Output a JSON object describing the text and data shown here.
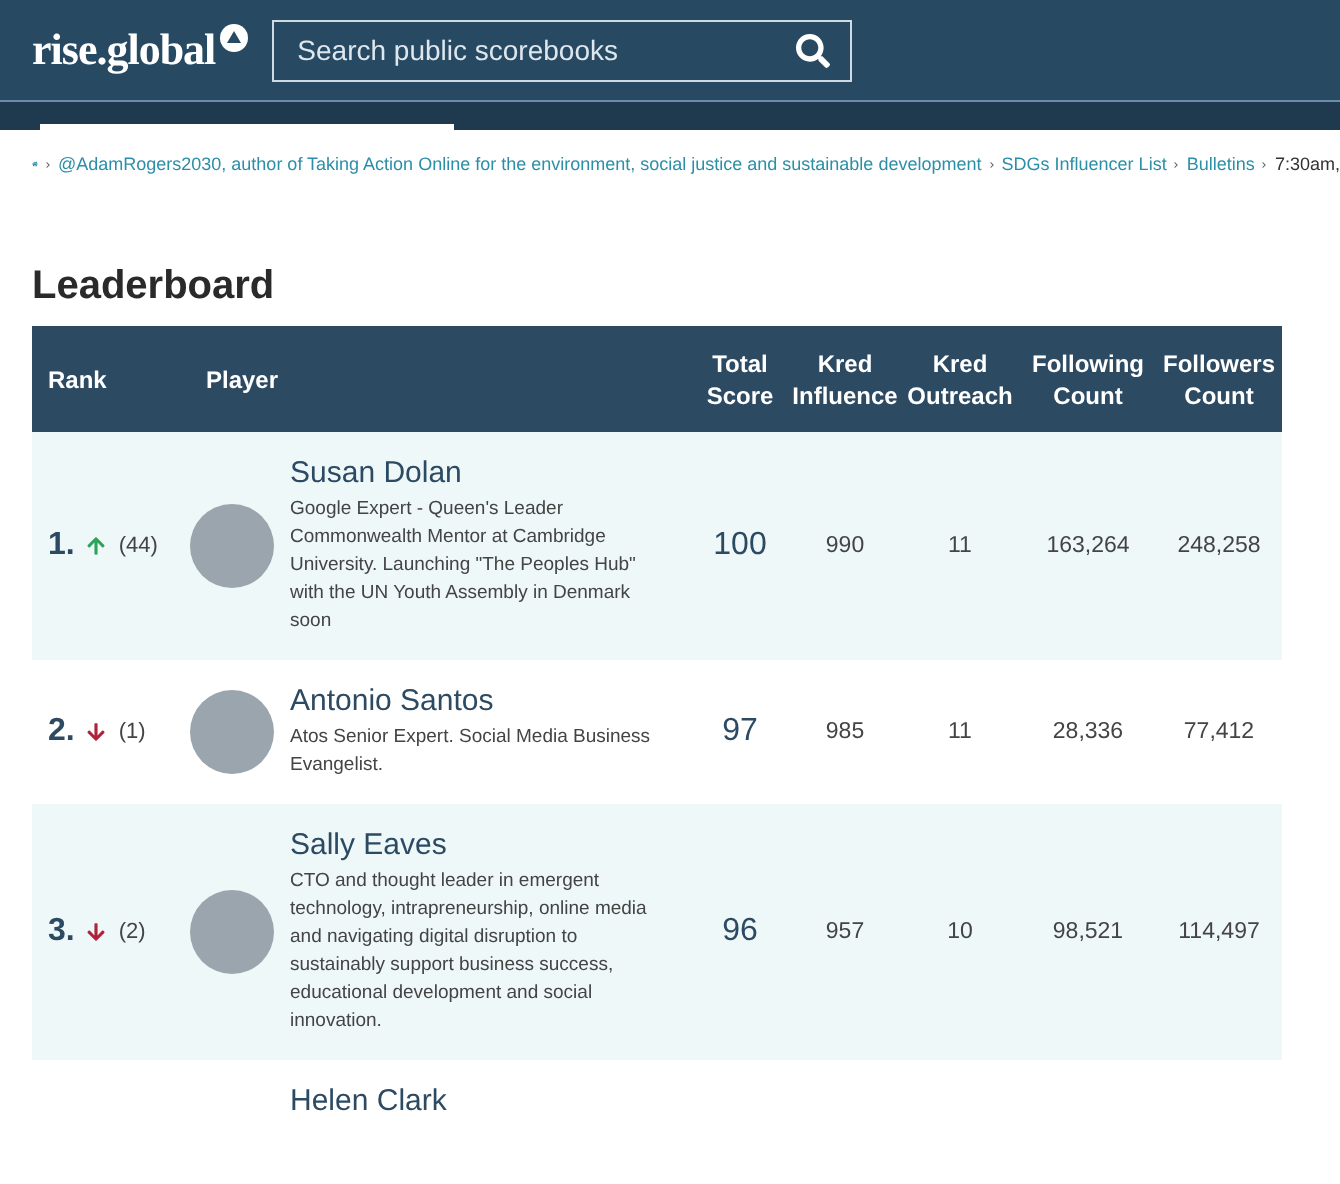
{
  "header": {
    "logo": "rise.global",
    "search": {
      "placeholder": "Search public scorebooks"
    }
  },
  "breadcrumb": [
    "@AdamRogers2030, author of Taking Action Online for the environment, social justice and sustainable development",
    "SDGs Influencer List",
    "Bulletins",
    "7:30am,"
  ],
  "title": "Leaderboard",
  "table": {
    "columns": [
      "Rank",
      "Player",
      "Total Score",
      "Kred Influence",
      "Kred Outreach",
      "Following Count",
      "Followers Count"
    ],
    "rows": [
      {
        "rank": "1.",
        "kind": "up",
        "change": "(44)",
        "name": "Susan Dolan",
        "bio": "Google Expert - Queen's Leader Commonwealth Mentor at Cambridge University. Launching \"The Peoples Hub\" with the UN Youth Assembly in Denmark soon",
        "score": "100",
        "influence": "990",
        "outreach": "11",
        "following": "163,264",
        "followers": "248,258"
      },
      {
        "rank": "2.",
        "kind": "down",
        "change": "(1)",
        "name": "Antonio Santos",
        "bio": "Atos Senior Expert. Social Media Business Evangelist.",
        "score": "97",
        "influence": "985",
        "outreach": "11",
        "following": "28,336",
        "followers": "77,412"
      },
      {
        "rank": "3.",
        "kind": "down",
        "change": "(2)",
        "name": "Sally Eaves",
        "bio": "CTO and thought leader in emergent technology, intrapreneurship, online media and navigating digital disruption to sustainably support business success, educational development and social innovation.",
        "score": "96",
        "influence": "957",
        "outreach": "10",
        "following": "98,521",
        "followers": "114,497"
      },
      {
        "name": "Helen Clark"
      }
    ]
  }
}
